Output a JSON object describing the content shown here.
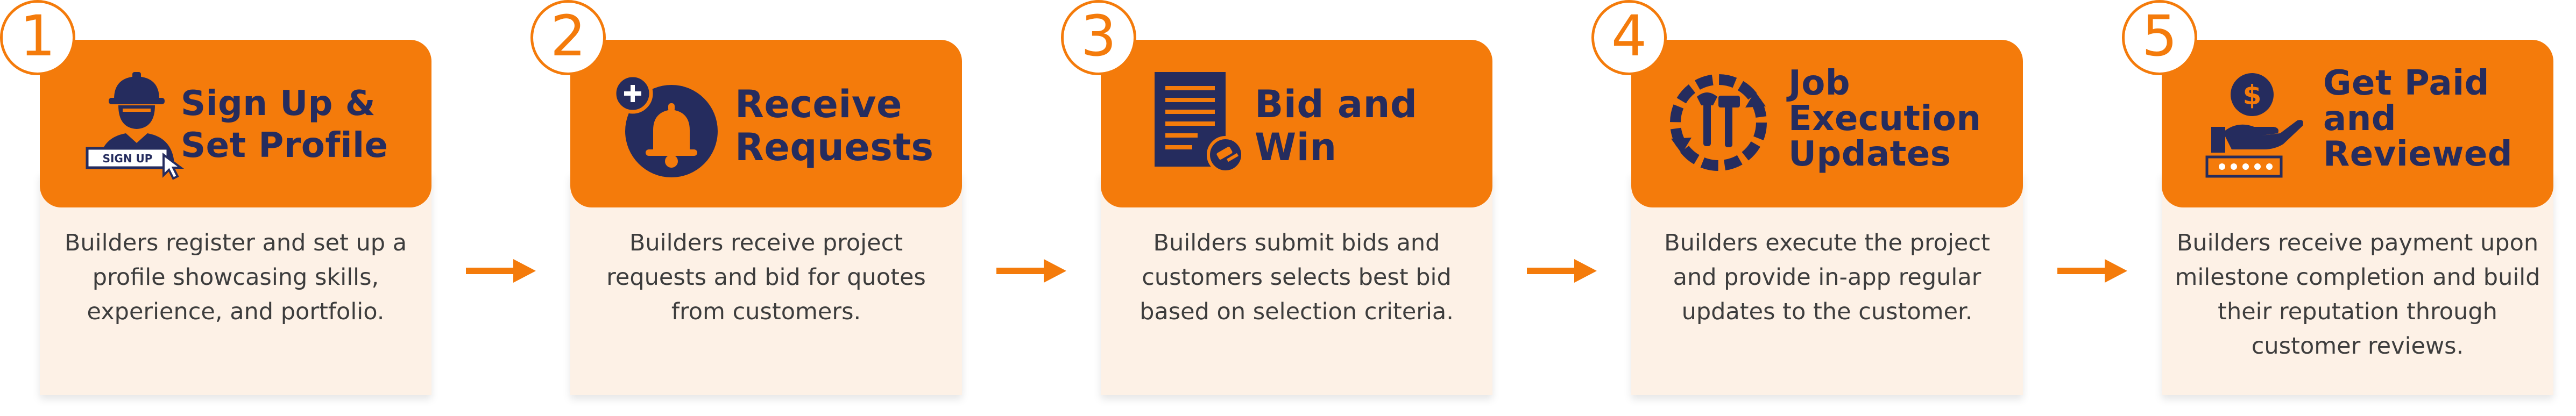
{
  "steps": [
    {
      "number": "1",
      "title": "Sign Up &\nSet Profile",
      "icon_label": "SIGN UP",
      "icon": "worker-signup-icon",
      "description": "Builders register and set up a profile showcasing skills, experience, and portfolio."
    },
    {
      "number": "2",
      "title": "Receive\nRequests",
      "icon": "notification-bell-icon",
      "description": "Builders receive project requests and bid for quotes from customers."
    },
    {
      "number": "3",
      "title": "Bid and\nWin",
      "icon": "document-bid-icon",
      "description": "Builders submit bids and customers selects best bid based on selection criteria."
    },
    {
      "number": "4",
      "title": "Job\nExecution\nUpdates",
      "icon": "tools-cycle-icon",
      "description": "Builders execute the project and provide in-app regular updates to the customer."
    },
    {
      "number": "5",
      "title": "Get Paid\nand\nReviewed",
      "icon": "payment-review-icon",
      "description": "Builders receive payment upon milestone completion and build their reputation through customer reviews."
    }
  ],
  "colors": {
    "accent": "#f47b0b",
    "navy": "#252c5e",
    "card_bg": "#fdf1e6",
    "text": "#3d3d3d"
  }
}
